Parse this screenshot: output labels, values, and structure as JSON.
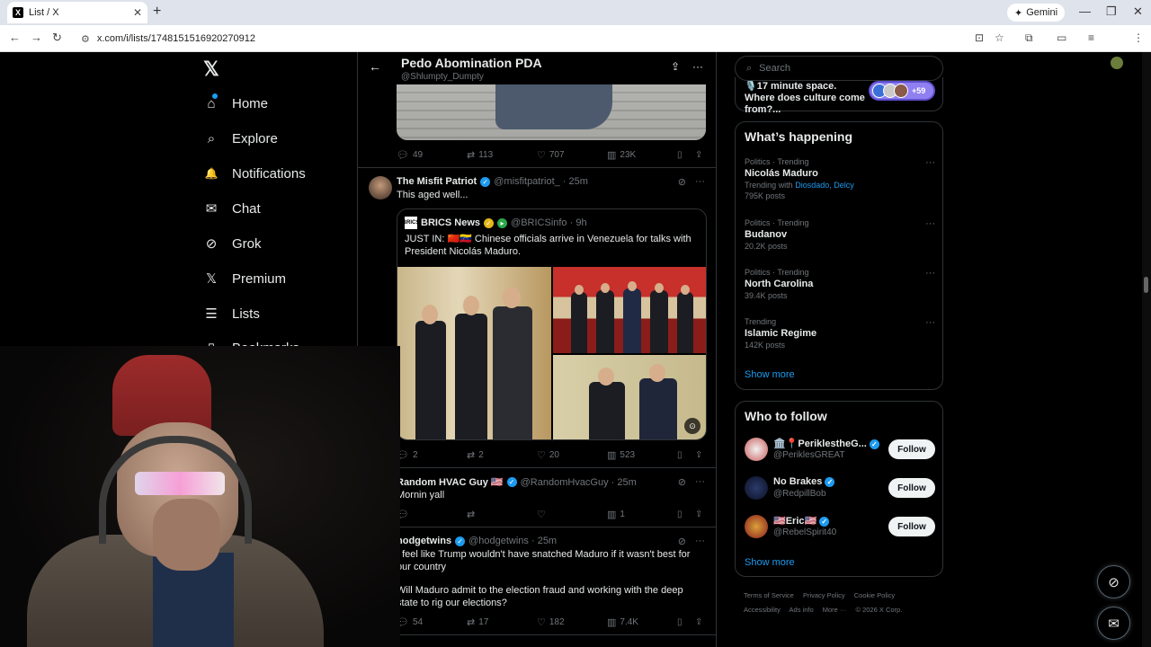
{
  "browser": {
    "tab_title": "List / X",
    "tab_favicon": "X",
    "new_tab": "+",
    "gemini_label": "Gemini",
    "url": "x.com/i/lists/1748151516920270912"
  },
  "nav": {
    "logo": "𝕏",
    "items": [
      {
        "label": "Home",
        "icon": "⌂"
      },
      {
        "label": "Explore",
        "icon": "⌕"
      },
      {
        "label": "Notifications",
        "icon": "🔔"
      },
      {
        "label": "Chat",
        "icon": "✉"
      },
      {
        "label": "Grok",
        "icon": "⊘"
      },
      {
        "label": "Premium",
        "icon": "𝕏"
      },
      {
        "label": "Lists",
        "icon": "☰"
      },
      {
        "label": "Bookmarks",
        "icon": "▯"
      }
    ]
  },
  "list_header": {
    "title": "Pedo Abomination PDA",
    "handle": "@Shlumpty_Dumpty"
  },
  "top_post_actions": {
    "replies": "49",
    "reposts": "113",
    "likes": "707",
    "views": "23K"
  },
  "post1": {
    "name": "The Misfit Patriot",
    "handle": "@misfitpatriot_ · 25m",
    "text": "This aged well...",
    "quote": {
      "name": "BRICS News",
      "handle": "@BRICSinfo · 9h",
      "logo": "BRICS",
      "text": "JUST IN: 🇨🇳🇻🇪 Chinese officials arrive in Venezuela for talks with President Nicolás Maduro."
    },
    "actions": {
      "replies": "2",
      "reposts": "2",
      "likes": "20",
      "views": "523"
    }
  },
  "post2": {
    "name": "Random HVAC Guy 🇺🇸",
    "handle": "@RandomHvacGuy · 25m",
    "text": "Mornin yall",
    "actions": {
      "replies": "",
      "reposts": "",
      "likes": "",
      "views": "1"
    }
  },
  "post3": {
    "name": "hodgetwins",
    "handle": "@hodgetwins · 25m",
    "text1": "I feel like Trump wouldn't have snatched Maduro if it wasn't best for our country",
    "text2": "Will Maduro admit to the election fraud and working with the deep state to rig our elections?",
    "actions": {
      "replies": "54",
      "reposts": "17",
      "likes": "182",
      "views": "7.4K"
    }
  },
  "search": {
    "placeholder": "Search"
  },
  "space": {
    "text": "🎙️17 minute space. Where does culture come from?...",
    "more": "+59"
  },
  "happening": {
    "title": "What’s happening",
    "trends": [
      {
        "meta": "Politics · Trending",
        "name": "Nicolás Maduro",
        "sub_prefix": "Trending with ",
        "sub_links": "Diosdado, Delcy",
        "posts": "795K posts"
      },
      {
        "meta": "Politics · Trending",
        "name": "Budanov",
        "posts": "20.2K posts"
      },
      {
        "meta": "Politics · Trending",
        "name": "North Carolina",
        "posts": "39.4K posts"
      },
      {
        "meta": "Trending",
        "name": "Islamic Regime",
        "posts": "142K posts"
      }
    ],
    "show_more": "Show more"
  },
  "who_to_follow": {
    "title": "Who to follow",
    "accounts": [
      {
        "name": "🏛️📍PeriklestheG...",
        "handle": "@PeriklesGREAT",
        "button": "Follow"
      },
      {
        "name": "No Brakes",
        "handle": "@RedpillBob",
        "button": "Follow"
      },
      {
        "name": "🇺🇸Eric🇺🇸",
        "handle": "@RebelSpirit40",
        "button": "Follow"
      }
    ],
    "show_more": "Show more"
  },
  "footer": {
    "links": [
      "Terms of Service",
      "Privacy Policy",
      "Cookie Policy",
      "Accessibility",
      "Ads info",
      "More ···",
      "© 2026 X Corp."
    ]
  },
  "colors": {
    "accent": "#1d9bf0",
    "background": "#000000",
    "border": "#2f3336",
    "muted": "#71767b"
  }
}
